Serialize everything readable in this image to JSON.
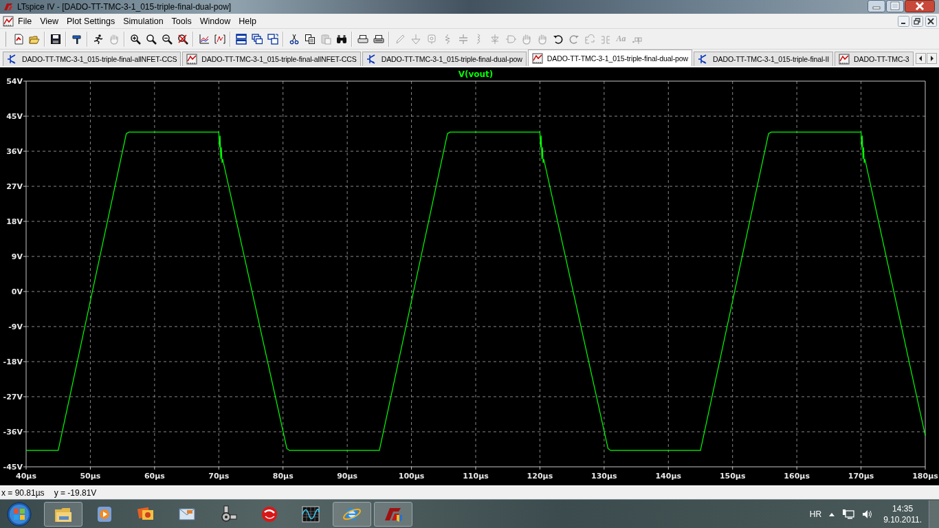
{
  "window": {
    "title": "LTspice IV - [DADO-TT-TMC-3-1_015-triple-final-dual-pow]"
  },
  "menu": [
    "File",
    "View",
    "Plot Settings",
    "Simulation",
    "Tools",
    "Window",
    "Help"
  ],
  "toolbar": [
    [
      {
        "kind": "new",
        "disabled": false
      },
      {
        "kind": "open",
        "disabled": false
      }
    ],
    [
      {
        "kind": "save",
        "disabled": false
      }
    ],
    [
      {
        "kind": "hammer",
        "disabled": false
      }
    ],
    [
      {
        "kind": "run",
        "disabled": false
      },
      {
        "kind": "hand",
        "disabled": true
      }
    ],
    [
      {
        "kind": "zoom-in",
        "disabled": false
      },
      {
        "kind": "zoom",
        "disabled": false
      },
      {
        "kind": "zoom-out",
        "disabled": false
      },
      {
        "kind": "zoom-reset",
        "disabled": false
      }
    ],
    [
      {
        "kind": "plot",
        "disabled": false
      },
      {
        "kind": "autorange",
        "disabled": false
      }
    ],
    [
      {
        "kind": "tile-h",
        "disabled": false
      },
      {
        "kind": "cascade",
        "disabled": false
      },
      {
        "kind": "tile-v",
        "disabled": false
      }
    ],
    [
      {
        "kind": "cut",
        "disabled": false
      },
      {
        "kind": "copy",
        "disabled": false
      },
      {
        "kind": "paste",
        "disabled": true
      },
      {
        "kind": "find",
        "disabled": false
      }
    ],
    [
      {
        "kind": "preview",
        "disabled": false
      },
      {
        "kind": "print",
        "disabled": false
      }
    ],
    [
      {
        "kind": "pencil",
        "disabled": true
      },
      {
        "kind": "ground",
        "disabled": true
      },
      {
        "kind": "label",
        "disabled": true
      },
      {
        "kind": "resistor",
        "disabled": true
      },
      {
        "kind": "capacitor",
        "disabled": true
      },
      {
        "kind": "inductor",
        "disabled": true
      },
      {
        "kind": "diode",
        "disabled": true
      },
      {
        "kind": "gate",
        "disabled": true
      },
      {
        "kind": "hand",
        "disabled": true
      },
      {
        "kind": "hand",
        "disabled": true
      },
      {
        "kind": "undo",
        "disabled": false
      },
      {
        "kind": "redo",
        "disabled": true
      },
      {
        "kind": "rotate",
        "disabled": true
      },
      {
        "kind": "mirror",
        "disabled": true
      },
      {
        "kind": "text",
        "label": "Aa",
        "disabled": true
      },
      {
        "kind": "directive",
        "disabled": true
      }
    ]
  ],
  "tabs": [
    {
      "kind": "schematic",
      "label": "DADO-TT-TMC-3-1_015-triple-final-allNFET-CCS",
      "selected": false
    },
    {
      "kind": "waveform",
      "label": "DADO-TT-TMC-3-1_015-triple-final-allNFET-CCS",
      "selected": false
    },
    {
      "kind": "schematic",
      "label": "DADO-TT-TMC-3-1_015-triple-final-dual-pow",
      "selected": false
    },
    {
      "kind": "waveform",
      "label": "DADO-TT-TMC-3-1_015-triple-final-dual-pow",
      "selected": true
    },
    {
      "kind": "schematic",
      "label": "DADO-TT-TMC-3-1_015-triple-final-II",
      "selected": false
    },
    {
      "kind": "waveform",
      "label": "DADO-TT-TMC-3",
      "selected": false
    }
  ],
  "plot": {
    "chart_data": {
      "type": "line",
      "grid": true,
      "x": [
        40,
        45,
        55.6,
        56,
        70,
        70.1,
        70.2,
        70.3,
        70.4,
        70.5,
        70.6,
        80.6,
        81,
        95,
        105.6,
        106,
        120,
        120.1,
        120.2,
        120.3,
        120.4,
        120.5,
        120.6,
        130.6,
        131,
        145,
        155.6,
        156,
        170,
        170.1,
        170.2,
        170.3,
        170.4,
        170.5,
        170.6,
        180
      ],
      "series": [
        {
          "name": "V(vout)",
          "color": "#00ff00",
          "values": [
            -40.8,
            -40.8,
            40.5,
            40.9,
            40.9,
            37,
            40,
            34,
            37,
            33,
            34,
            -40.3,
            -40.8,
            -40.8,
            40.5,
            40.9,
            40.9,
            37,
            40,
            34,
            37,
            33,
            34,
            -40.3,
            -40.8,
            -40.8,
            40.5,
            40.9,
            40.9,
            37,
            40,
            34,
            37,
            33,
            34,
            -37
          ]
        }
      ],
      "xlim": [
        40,
        180
      ],
      "ylim": [
        -45,
        54
      ],
      "xticks": [
        {
          "value": 40,
          "label": "40µs"
        },
        {
          "value": 50,
          "label": "50µs"
        },
        {
          "value": 60,
          "label": "60µs"
        },
        {
          "value": 70,
          "label": "70µs"
        },
        {
          "value": 80,
          "label": "80µs"
        },
        {
          "value": 90,
          "label": "90µs"
        },
        {
          "value": 100,
          "label": "100µs"
        },
        {
          "value": 110,
          "label": "110µs"
        },
        {
          "value": 120,
          "label": "120µs"
        },
        {
          "value": 130,
          "label": "130µs"
        },
        {
          "value": 140,
          "label": "140µs"
        },
        {
          "value": 150,
          "label": "150µs"
        },
        {
          "value": 160,
          "label": "160µs"
        },
        {
          "value": 170,
          "label": "170µs"
        },
        {
          "value": 180,
          "label": "180µs"
        }
      ],
      "yticks": [
        {
          "value": 54,
          "label": "54V"
        },
        {
          "value": 45,
          "label": "45V"
        },
        {
          "value": 36,
          "label": "36V"
        },
        {
          "value": 27,
          "label": "27V"
        },
        {
          "value": 18,
          "label": "18V"
        },
        {
          "value": 9,
          "label": "9V"
        },
        {
          "value": 0,
          "label": "0V"
        },
        {
          "value": -9,
          "label": "-9V"
        },
        {
          "value": -18,
          "label": "-18V"
        },
        {
          "value": -27,
          "label": "-27V"
        },
        {
          "value": -36,
          "label": "-36V"
        },
        {
          "value": -45,
          "label": "-45V"
        }
      ]
    }
  },
  "status_bar": {
    "x_reading": "x = 90.81µs",
    "y_reading": "y = -19.81V"
  },
  "taskbar": {
    "apps": [
      {
        "kind": "explorer",
        "running": true
      },
      {
        "kind": "media",
        "running": false
      },
      {
        "kind": "photos",
        "running": false
      },
      {
        "kind": "mail",
        "running": false
      },
      {
        "kind": "device",
        "running": false
      },
      {
        "kind": "antivirus",
        "running": false
      },
      {
        "kind": "scope",
        "running": false
      },
      {
        "kind": "browser",
        "running": true
      },
      {
        "kind": "ltspice",
        "running": true
      }
    ],
    "language": "HR",
    "time": "14:35",
    "date": "9.10.2011."
  }
}
